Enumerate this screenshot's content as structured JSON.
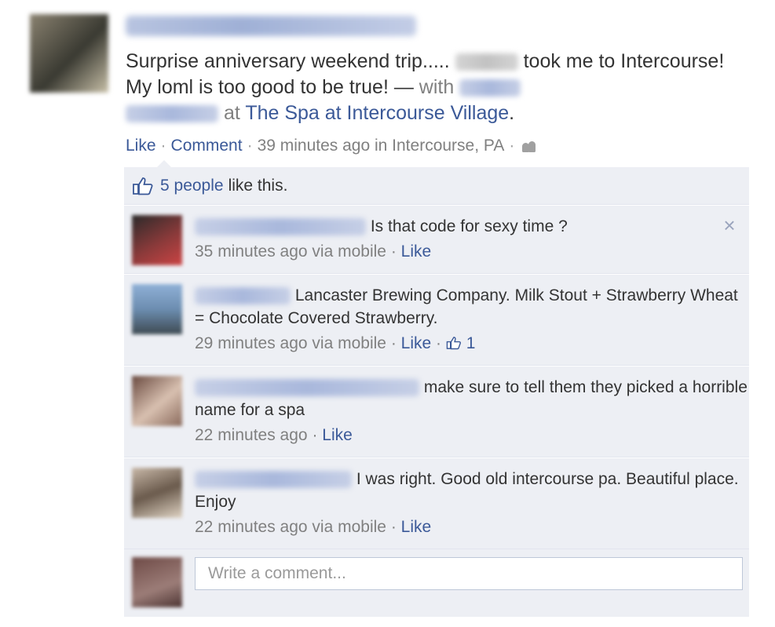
{
  "post": {
    "text_part1": "Surprise anniversary weekend trip.....",
    "text_part2": "took me to Intercourse! My loml is too good to be true! —",
    "with_label": "with",
    "at_label": "at",
    "place_link": "The Spa at Intercourse Village",
    "period": "."
  },
  "actions": {
    "like": "Like",
    "comment": "Comment",
    "time": "39 minutes ago in Intercourse, PA",
    "sep": "·",
    "audience_icon": "friends-icon"
  },
  "likes": {
    "icon": "thumbs-up-icon",
    "count_link": "5 people",
    "suffix": "like this."
  },
  "comments": [
    {
      "text": "Is that code for sexy time ?",
      "time": "35 minutes ago via mobile",
      "like": "Like",
      "avatar_color": "#8a3a3a"
    },
    {
      "text": "Lancaster Brewing Company. Milk Stout + Strawberry Wheat = Chocolate Covered Strawberry.",
      "time": "29 minutes ago via mobile",
      "like": "Like",
      "like_count": "1",
      "avatar_color": "#6c8db0"
    },
    {
      "text": "make sure to tell them they picked a horrible name for a spa",
      "time": "22 minutes ago",
      "like": "Like",
      "avatar_color": "#a07a6c"
    },
    {
      "text": "I was right. Good old intercourse pa. Beautiful place. Enjoy",
      "time": "22 minutes ago via mobile",
      "like": "Like",
      "avatar_color": "#8c7a6a"
    }
  ],
  "composer": {
    "placeholder": "Write a comment..."
  },
  "colors": {
    "link": "#3b5998",
    "ufi_bg": "#edeff4",
    "muted": "#808080"
  }
}
